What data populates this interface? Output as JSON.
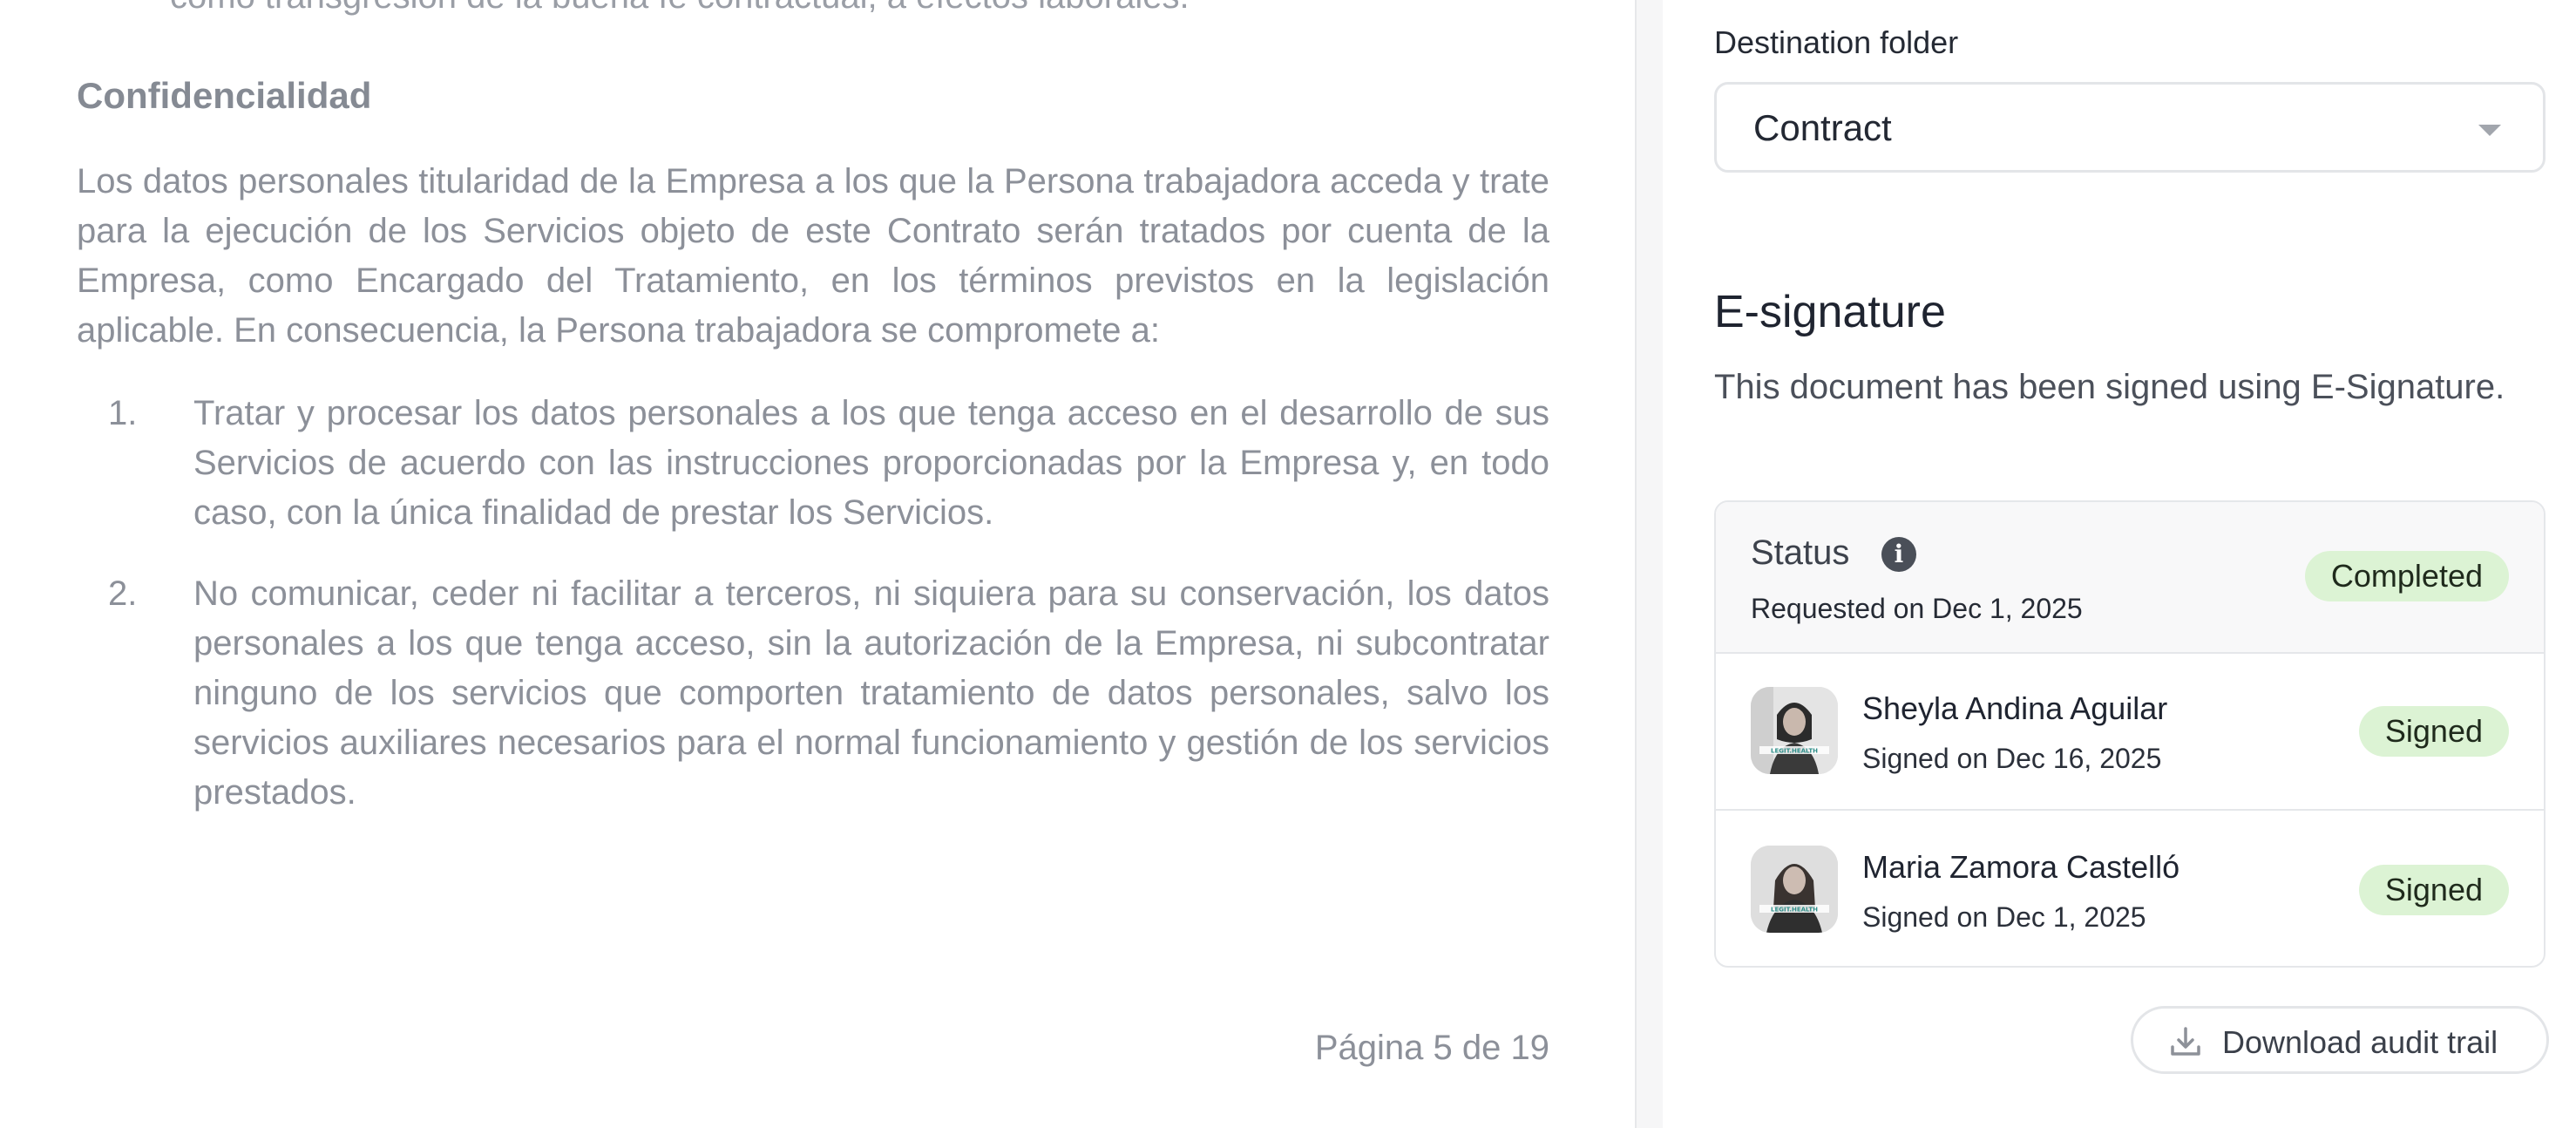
{
  "document": {
    "cut_line": "como transgresión de la buena fe contractual, a efectos laborales.",
    "heading": "Confidencialidad",
    "paragraph": "Los datos personales titularidad de la Empresa a los que la Persona trabajadora acceda y trate para la ejecución de los Servicios objeto de este Contrato serán tratados por cuenta de la Empresa, como Encargado del Tratamiento, en los términos previstos en la legislación aplicable. En consecuencia, la Persona trabajadora  se compromete a:",
    "list": [
      {
        "number": "1.",
        "text": "Tratar y procesar los datos personales a los que tenga acceso en el desarrollo de sus Servicios de acuerdo con las instrucciones proporcionadas por la Empresa y, en todo caso, con la única finalidad de prestar los Servicios."
      },
      {
        "number": "2.",
        "text": "No comunicar, ceder ni facilitar a terceros, ni siquiera para su conservación, los datos personales a los que tenga acceso, sin la autorización de la Empresa, ni subcontratar ninguno de los servicios que comporten tratamiento de datos personales, salvo los servicios auxiliares necesarios para el normal funcionamiento y gestión de los servicios prestados."
      }
    ],
    "page_number": "Página 5 de 19"
  },
  "panel": {
    "destination_label": "Destination folder",
    "destination_value": "Contract",
    "esignature_title": "E-signature",
    "esignature_description": "This document has been signed using E-Signature.",
    "status": {
      "label": "Status",
      "requested": "Requested on Dec 1, 2025",
      "badge": "Completed"
    },
    "signers": [
      {
        "name": "Sheyla Andina Aguilar",
        "date": "Signed on Dec 16, 2025",
        "badge": "Signed",
        "avatar_logo": "LEGIT.HEALTH"
      },
      {
        "name": "Maria Zamora Castelló",
        "date": "Signed on Dec 1, 2025",
        "badge": "Signed",
        "avatar_logo": "LEGIT.HEALTH"
      }
    ],
    "download_label": "Download audit trail"
  },
  "colors": {
    "badge_bg": "#dcf3d4",
    "doc_text": "#8c9099",
    "info_icon": "#4a4f58"
  }
}
